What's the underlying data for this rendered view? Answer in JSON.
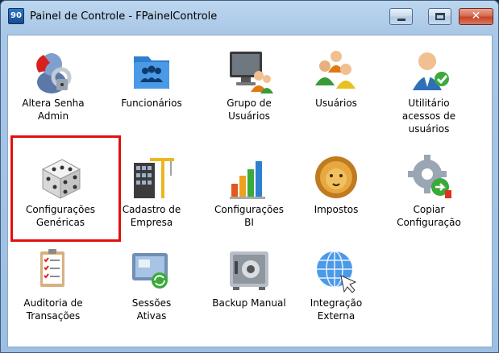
{
  "window": {
    "app_icon_text": "90",
    "title": "Painel de Controle - FPainelControle",
    "close_glyph": "✕"
  },
  "items": [
    {
      "label": "Altera Senha\nAdmin",
      "icon": "altera-senha-icon"
    },
    {
      "label": "Funcionários",
      "icon": "funcionarios-icon"
    },
    {
      "label": "Grupo de\nUsuários",
      "icon": "grupo-usuarios-icon"
    },
    {
      "label": "Usuários",
      "icon": "usuarios-icon"
    },
    {
      "label": "Utilitário\nacessos de\nusuários",
      "icon": "utilitario-acessos-icon"
    },
    {
      "label": "Configurações\nGenéricas",
      "icon": "configuracoes-genericas-icon"
    },
    {
      "label": "Cadastro de\nEmpresa",
      "icon": "cadastro-empresa-icon"
    },
    {
      "label": "Configurações\nBI",
      "icon": "configuracoes-bi-icon"
    },
    {
      "label": "Impostos",
      "icon": "impostos-icon"
    },
    {
      "label": "Copiar\nConfiguração",
      "icon": "copiar-configuracao-icon"
    },
    {
      "label": "Auditoria de\nTransações",
      "icon": "auditoria-transacoes-icon"
    },
    {
      "label": "Sessões\nAtivas",
      "icon": "sessoes-ativas-icon"
    },
    {
      "label": "Backup Manual",
      "icon": "backup-manual-icon"
    },
    {
      "label": "Integração\nExterna",
      "icon": "integracao-externa-icon"
    }
  ],
  "selected_item": "Configurações Genéricas",
  "colors": {
    "selection_border": "#e01010",
    "title_bar": "#a9c7e6"
  }
}
